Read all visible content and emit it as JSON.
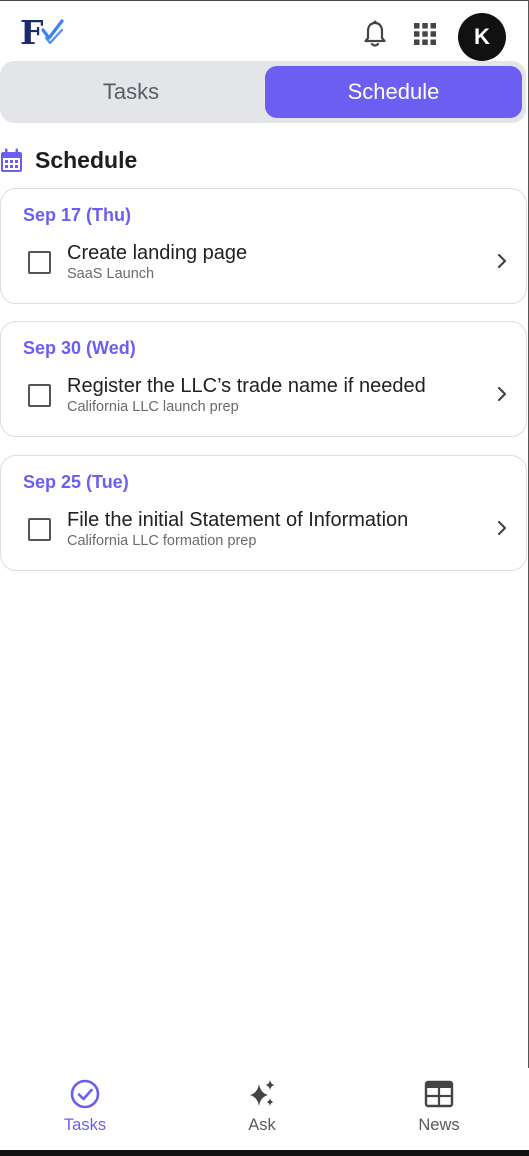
{
  "app": {
    "logo_text": "F",
    "avatar_initial": "K",
    "accent_color": "#6b5ef0"
  },
  "header": {
    "icons": [
      "bell-icon",
      "apps-grid-icon"
    ]
  },
  "tabs": [
    {
      "label": "Tasks",
      "selected": false
    },
    {
      "label": "Schedule",
      "selected": true
    }
  ],
  "section": {
    "title": "Schedule",
    "icon": "calendar-icon"
  },
  "schedule": [
    {
      "date": "Sep 17 (Thu)",
      "title": "Create landing page",
      "project": "SaaS Launch",
      "checked": false
    },
    {
      "date": "Sep 30 (Wed)",
      "title": "Register the LLC’s trade name if needed",
      "project": "California LLC launch prep",
      "checked": false
    },
    {
      "date": "Sep 25 (Tue)",
      "title": "File the initial Statement of Information",
      "project": "California LLC formation prep",
      "checked": false
    }
  ],
  "bottom_nav": [
    {
      "label": "Tasks",
      "icon": "check-circle-icon",
      "active": true
    },
    {
      "label": "Ask",
      "icon": "sparkles-icon",
      "active": false
    },
    {
      "label": "News",
      "icon": "newspaper-icon",
      "active": false
    }
  ]
}
